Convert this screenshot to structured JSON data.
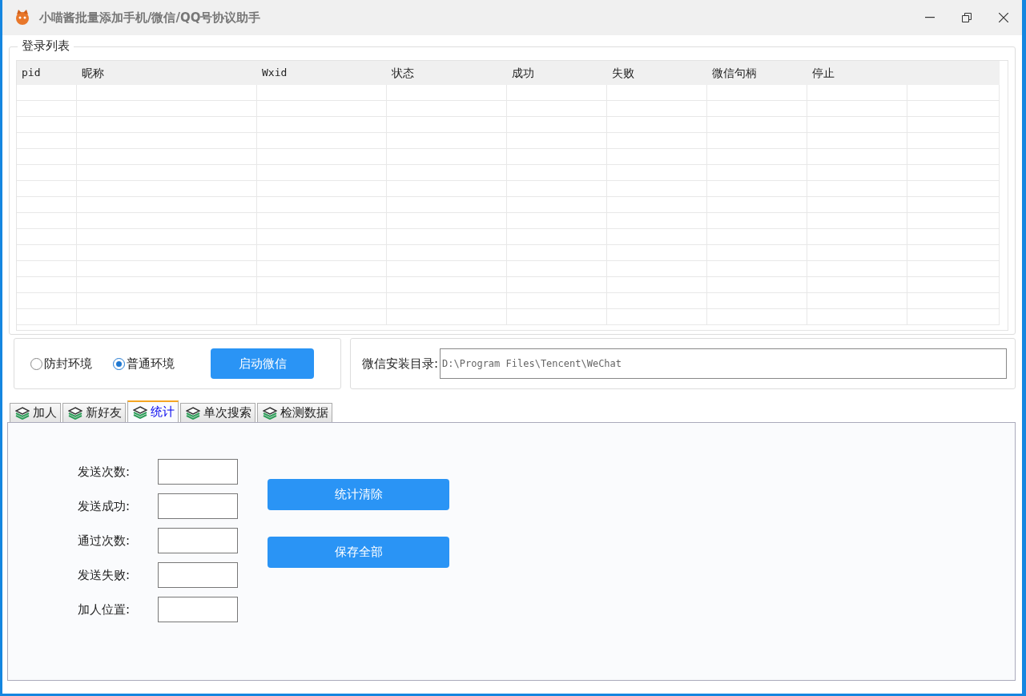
{
  "window": {
    "title": "小喵酱批量添加手机/微信/QQ号协议助手"
  },
  "login_list": {
    "title": "登录列表",
    "columns": [
      "pid",
      "昵称",
      "Wxid",
      "状态",
      "成功",
      "失败",
      "微信句柄",
      "停止"
    ]
  },
  "environment": {
    "options": [
      {
        "label": "防封环境",
        "selected": false
      },
      {
        "label": "普通环境",
        "selected": true
      }
    ],
    "button": "启动微信"
  },
  "install_path": {
    "label": "微信安装目录:",
    "value": "D:\\Program Files\\Tencent\\WeChat"
  },
  "tabs": [
    {
      "label": "加人",
      "selected": false
    },
    {
      "label": "新好友",
      "selected": false
    },
    {
      "label": "统计",
      "selected": true
    },
    {
      "label": "单次搜索",
      "selected": false
    },
    {
      "label": "检测数据",
      "selected": false
    }
  ],
  "stats": {
    "fields": [
      {
        "label": "发送次数:"
      },
      {
        "label": "发送成功:"
      },
      {
        "label": "通过次数:"
      },
      {
        "label": "发送失败:"
      },
      {
        "label": "加人位置:"
      }
    ],
    "buttons": [
      "统计清除",
      "保存全部"
    ]
  }
}
